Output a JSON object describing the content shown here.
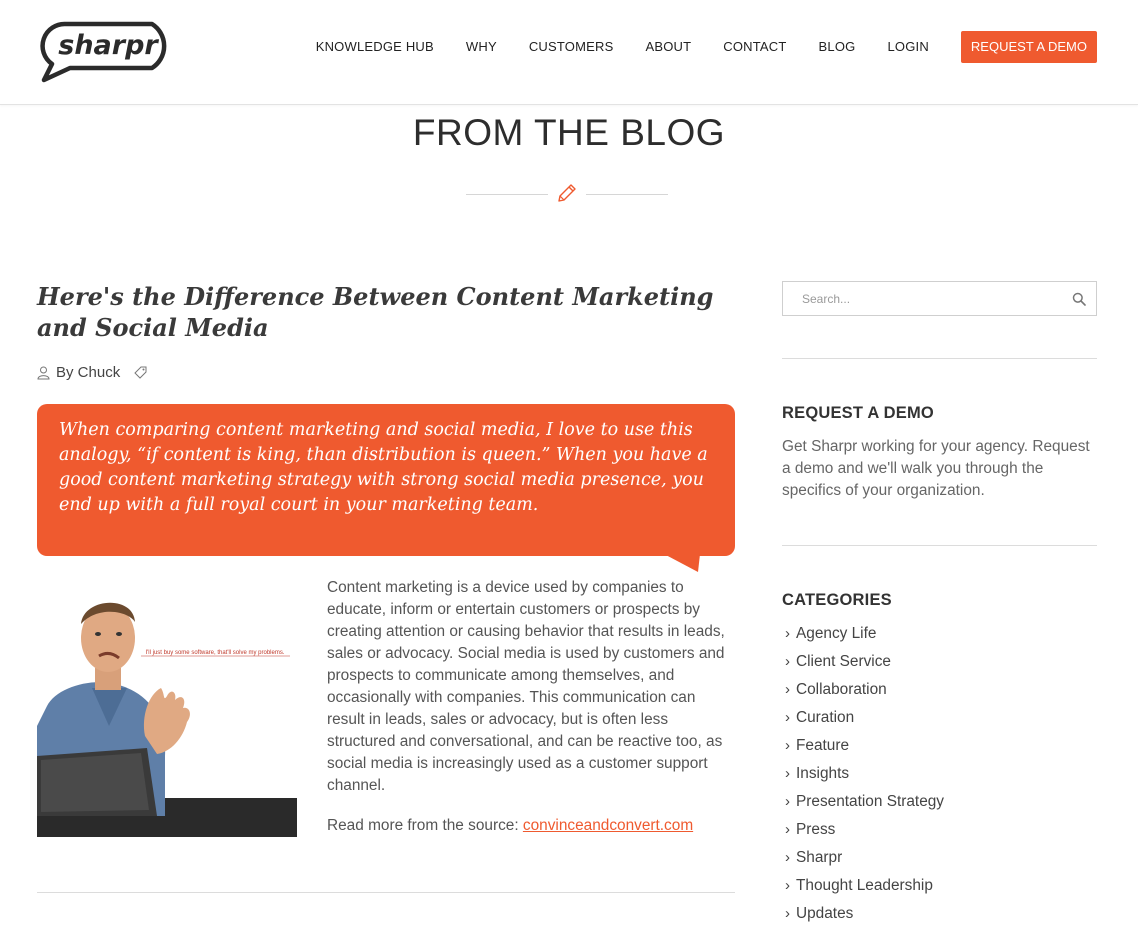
{
  "header": {
    "logo_text": "sharpr",
    "nav": [
      {
        "label": "KNOWLEDGE HUB"
      },
      {
        "label": "WHY"
      },
      {
        "label": "CUSTOMERS"
      },
      {
        "label": "ABOUT"
      },
      {
        "label": "CONTACT"
      },
      {
        "label": "BLOG"
      },
      {
        "label": "LOGIN"
      }
    ],
    "cta_label": "REQUEST A DEMO"
  },
  "page": {
    "title": "FROM THE BLOG",
    "divider_icon": "pen-icon"
  },
  "post": {
    "title": "Here's the Difference Between Content Marketing and Social Media",
    "author": "By Chuck",
    "author_icon": "user-icon",
    "tag_icon": "tag-icon",
    "quote": "When comparing content marketing and social media, I love to use this analogy, “if content is king, than distribution is queen.” When you have a good content marketing strategy with strong social media presence, you end up with a full royal court in your marketing team.",
    "image_caption": "I'll just buy some software, that'll solve my problems.",
    "body": "Content marketing is a device used by companies to educate, inform or entertain customers or prospects by creating attention or causing behavior that results in leads, sales or advocacy. Social media is used by customers and prospects to communicate among themselves, and occasionally with companies. This communication can result in leads, sales or advocacy, but is often less structured and conversational, and can be reactive too, as social media is increasingly used as a customer support channel.",
    "source_prefix": "Read more from the source: ",
    "source_link": "convinceandconvert.com"
  },
  "sidebar": {
    "search_placeholder": "Search...",
    "demo_heading": "REQUEST A DEMO",
    "demo_text": "Get Sharpr working for your agency. Request a demo and we'll walk you through the specifics of your organization.",
    "categories_heading": "CATEGORIES",
    "categories": [
      {
        "label": "Agency Life"
      },
      {
        "label": "Client Service"
      },
      {
        "label": "Collaboration"
      },
      {
        "label": "Curation"
      },
      {
        "label": "Feature"
      },
      {
        "label": "Insights"
      },
      {
        "label": "Presentation Strategy"
      },
      {
        "label": "Press"
      },
      {
        "label": "Sharpr"
      },
      {
        "label": "Thought Leadership"
      },
      {
        "label": "Updates"
      }
    ]
  },
  "colors": {
    "accent": "#ef5a2f",
    "text": "#333333",
    "muted": "#666666",
    "divider": "#dcdcdc"
  }
}
